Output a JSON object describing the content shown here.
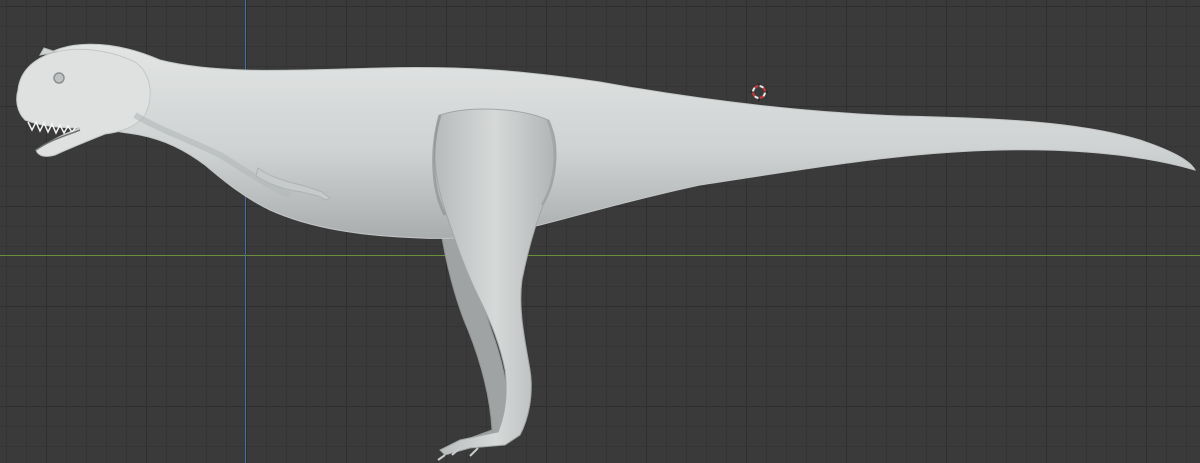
{
  "viewport": {
    "background_color": "#3a3a3a",
    "grid_color": "#303030",
    "x_axis_color": "#6b8f3a",
    "z_axis_color": "#3f6fa6"
  },
  "model": {
    "fill": "#d8dada",
    "shade": "#a9adad",
    "edge": "#c6c9c9"
  },
  "cursor": {
    "ring_color_a": "#e8e8e8",
    "ring_color_b": "#d23b3b"
  }
}
